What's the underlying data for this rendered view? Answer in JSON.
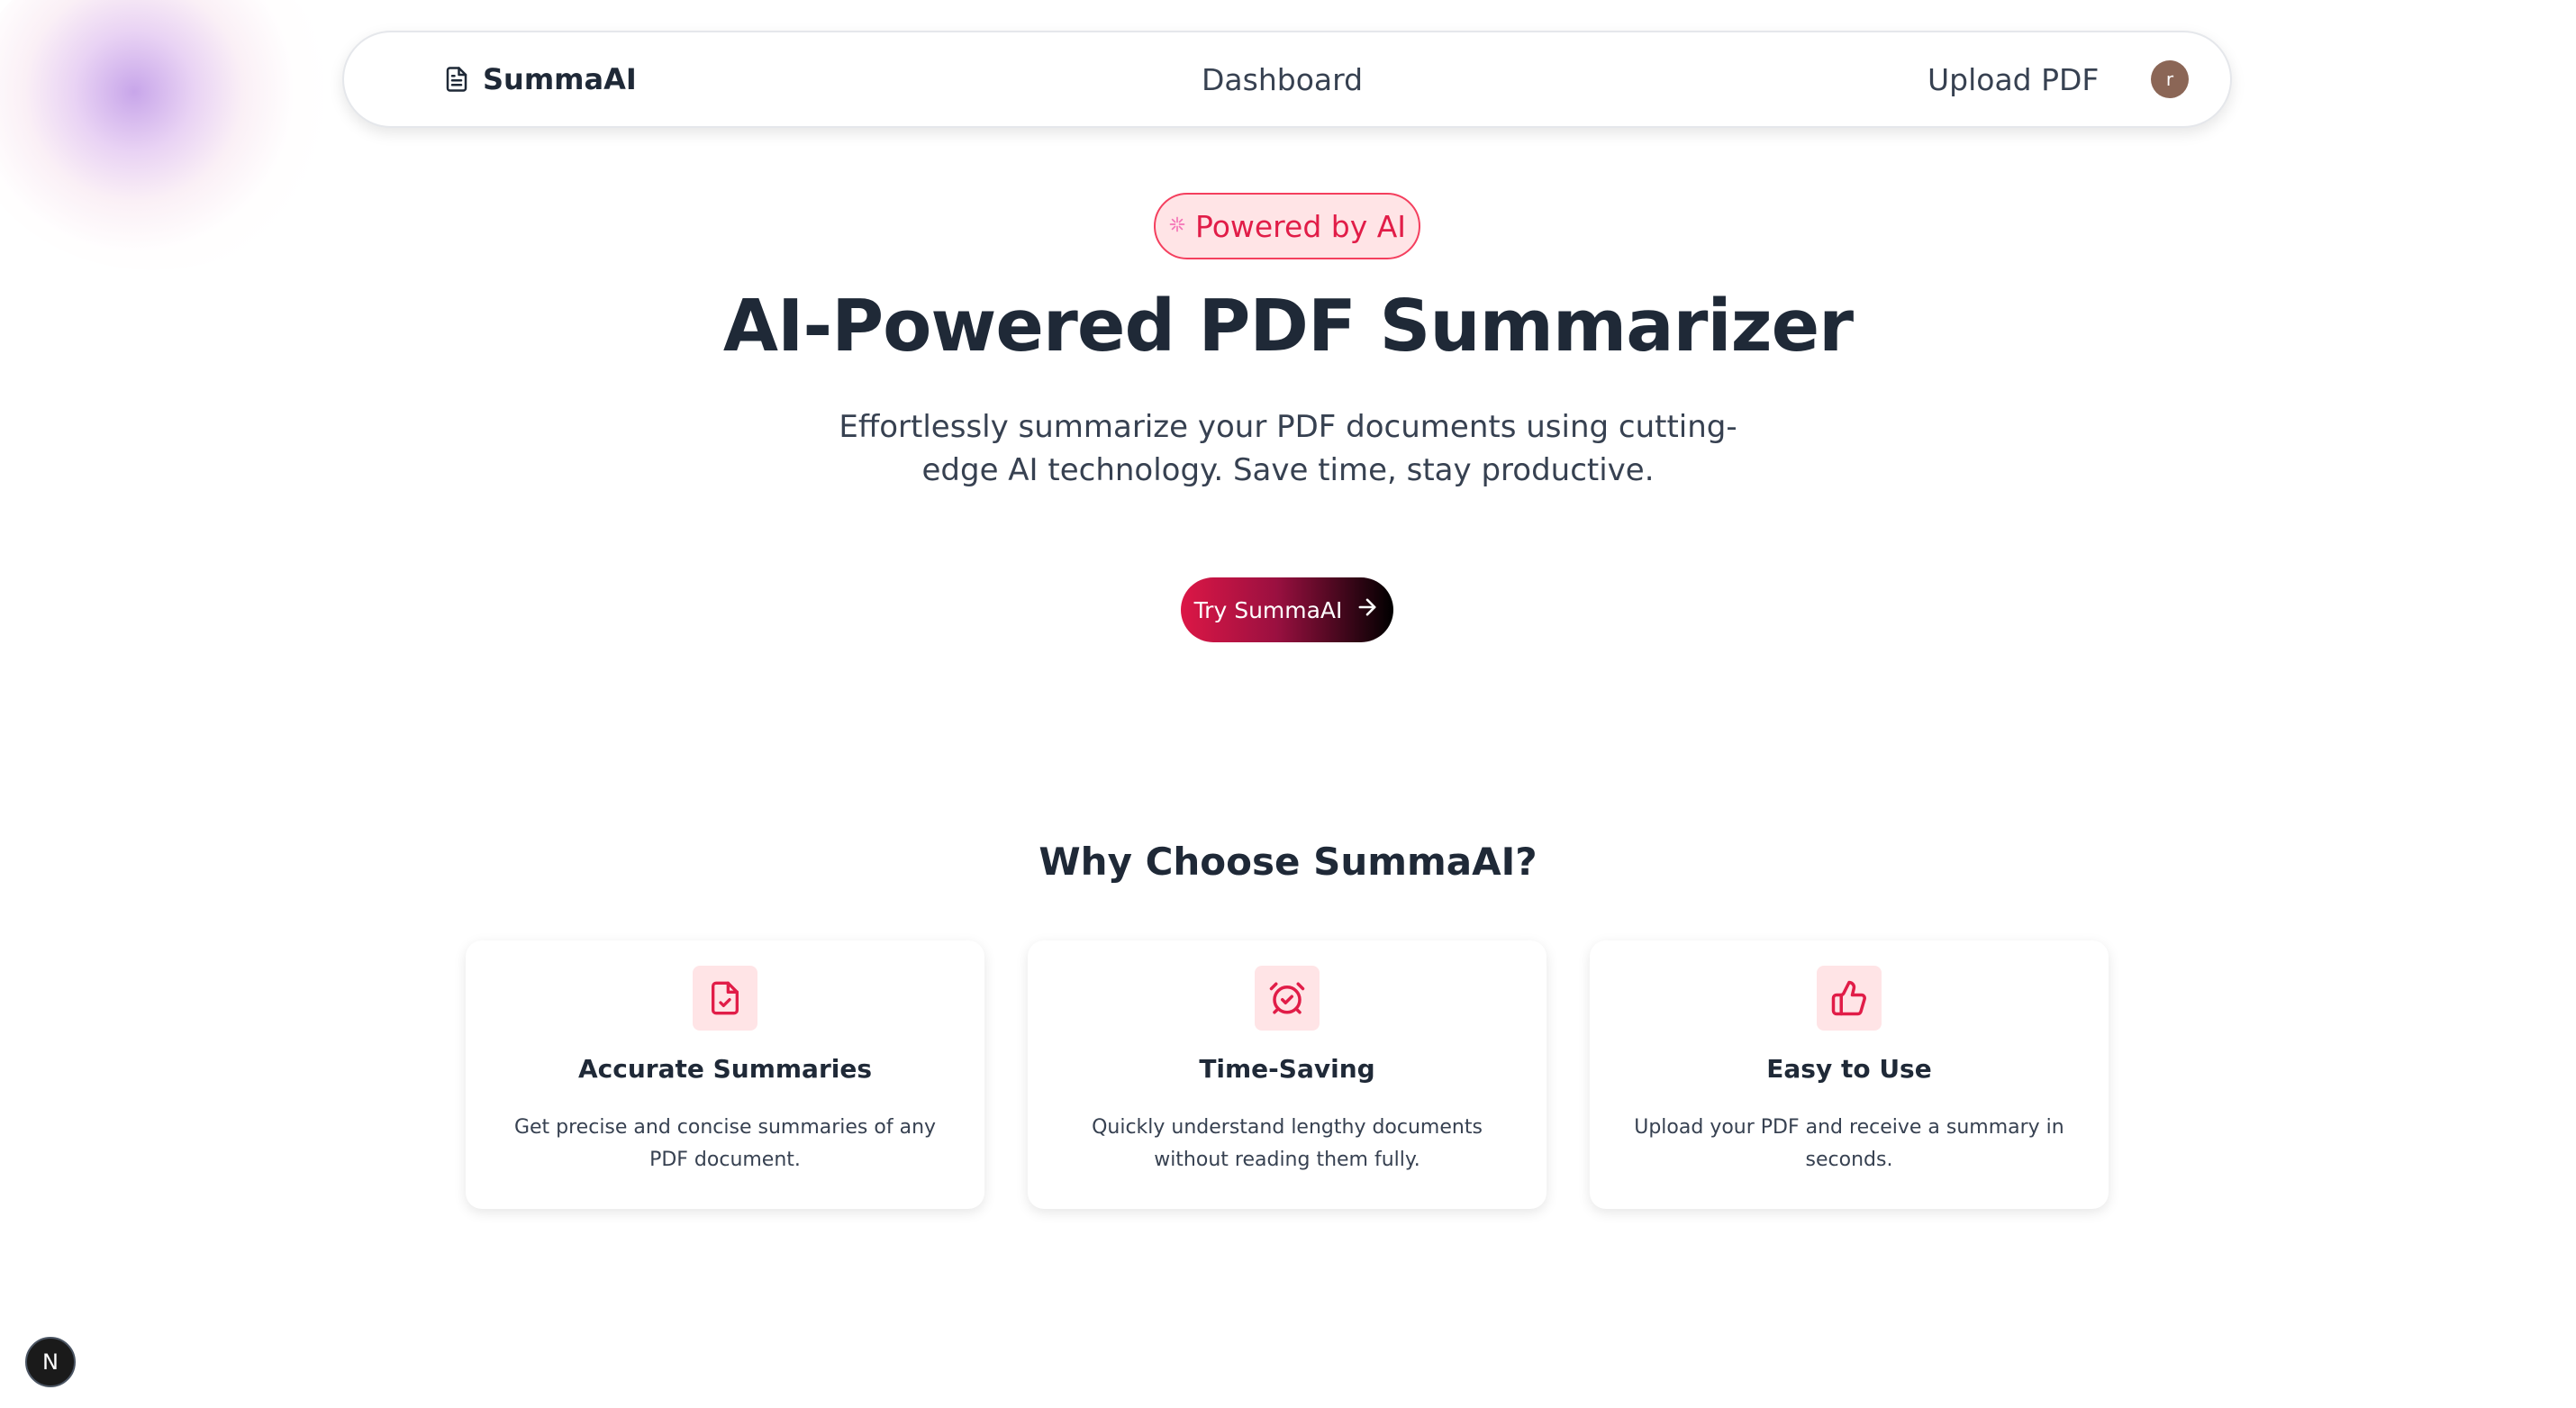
{
  "nav": {
    "brand": "SummaAI",
    "links": [
      "Dashboard",
      "Upload PDF"
    ],
    "avatar_initial": "r",
    "avatar_color": "#8b6656"
  },
  "hero": {
    "badge": "Powered by AI",
    "badge_icon": "sparkles-icon",
    "title": "AI-Powered PDF Summarizer",
    "subtitle": "Effortlessly summarize your PDF documents using cutting-edge AI technology. Save time, stay productive.",
    "cta_label": "Try SummaAI",
    "cta_icon": "arrow-right-icon"
  },
  "features": {
    "heading": "Why Choose SummaAI?",
    "cards": [
      {
        "icon": "file-check-icon",
        "title": "Accurate Summaries",
        "description": "Get precise and concise summaries of any PDF document."
      },
      {
        "icon": "alarm-clock-check-icon",
        "title": "Time-Saving",
        "description": "Quickly understand lengthy documents without reading them fully."
      },
      {
        "icon": "thumbs-up-icon",
        "title": "Easy to Use",
        "description": "Upload your PDF and receive a summary in seconds."
      }
    ]
  },
  "devtools": {
    "label": "N"
  },
  "colors": {
    "accent": "#e11d48",
    "accent_light": "#ffe4e6",
    "text_dark": "#1f2937"
  }
}
